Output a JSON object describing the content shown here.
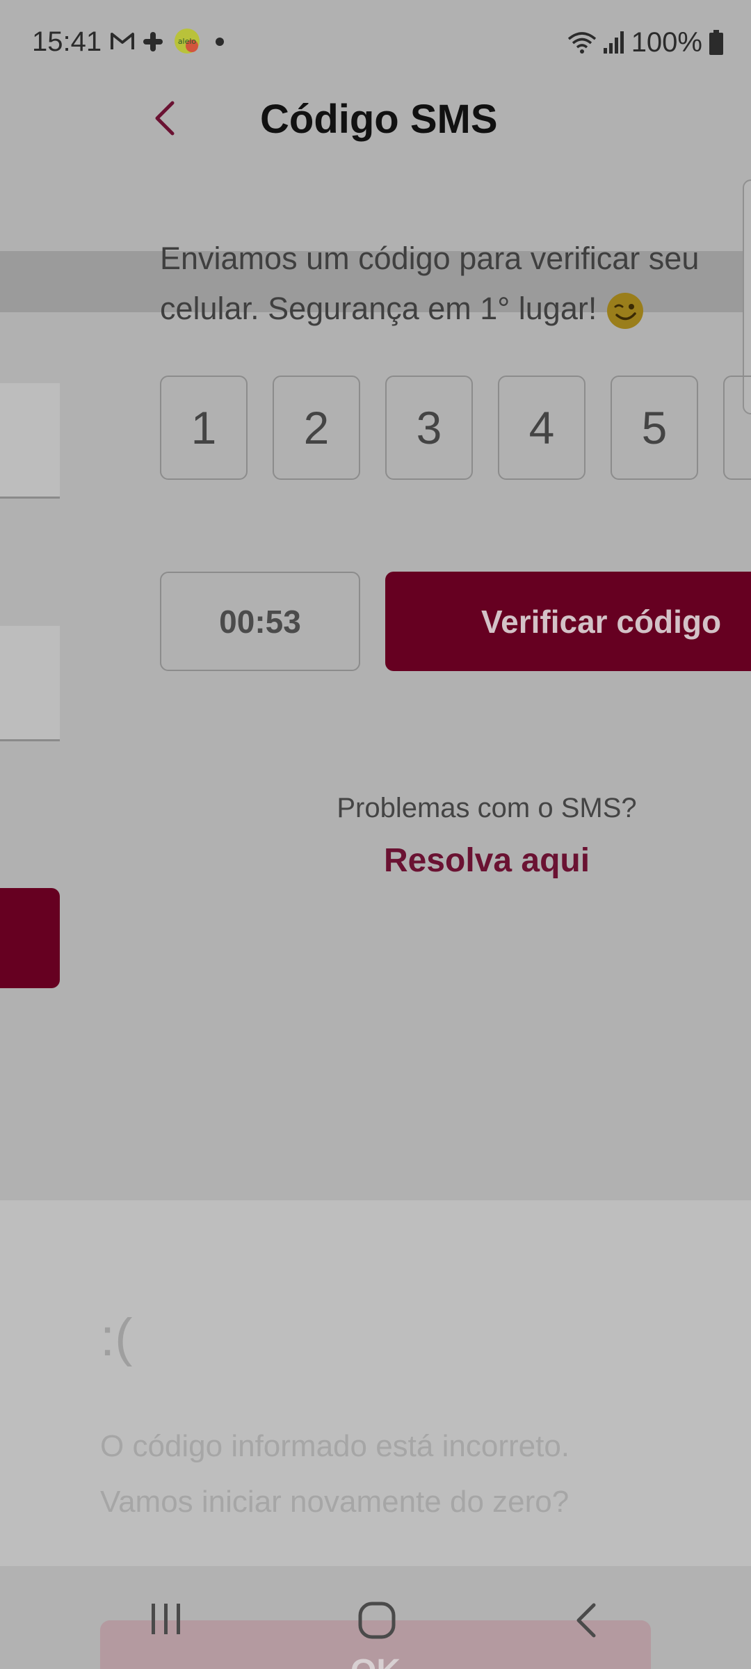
{
  "status_bar": {
    "time": "15:41",
    "battery": "100%",
    "icons": [
      "gmail-icon",
      "slack-icon",
      "alelo-app-icon",
      "notification-dot-icon",
      "wifi-icon",
      "signal-icon",
      "battery-icon"
    ]
  },
  "header": {
    "title": "Código SMS",
    "back_icon": "chevron-left-icon"
  },
  "message": {
    "line1": "Enviamos um código para verificar seu",
    "line2": "celular. Segurança em 1° lugar!",
    "emoji": "wink-emoji-icon"
  },
  "code_digits": [
    "1",
    "2",
    "3",
    "4",
    "5",
    ""
  ],
  "timer": "00:53",
  "verify_button": "Verificar código",
  "problems": {
    "question": "Problemas com o SMS?",
    "link": "Resolva aqui"
  },
  "error_sheet": {
    "face": ":(",
    "message": "O código informado está incorreto.\nVamos iniciar novamente do zero?",
    "ok_button": "OK"
  },
  "colors": {
    "brand": "#660021",
    "link": "#6a1232",
    "overlay": "#b1b1b1"
  },
  "nav_bar": [
    "recents-icon",
    "home-icon",
    "back-icon"
  ]
}
